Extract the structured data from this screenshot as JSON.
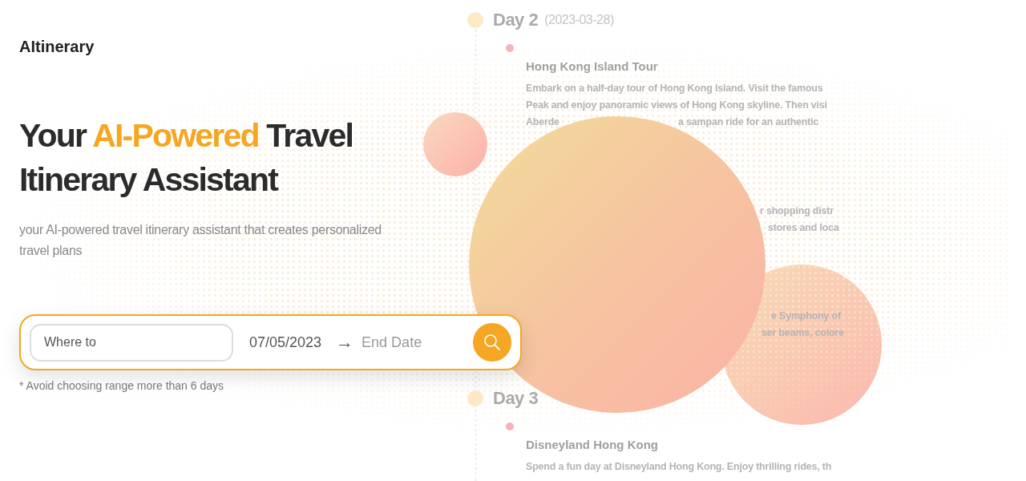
{
  "brand": "AItinerary",
  "hero": {
    "heading_before": "Your ",
    "heading_highlight": "AI-Powered",
    "heading_after": " Travel Itinerary Assistant",
    "subtitle": "your AI-powered travel itinerary assistant that creates personalized travel plans"
  },
  "search": {
    "destination_placeholder": "Where to",
    "start_date": "07/05/2023",
    "arrow": "→",
    "end_date_placeholder": "End Date",
    "note": "* Avoid choosing range more than 6 days"
  },
  "itinerary": {
    "days": [
      {
        "title": "Day 2",
        "date": "(2023-03-28)",
        "activities": [
          {
            "title": "Hong Kong Island Tour",
            "lines": [
              [
                "Embark on a half-day tour of Hong Kong Island. Visit the famous"
              ],
              [
                "Peak and enjoy panoramic views of Hong Kong skyline. Then visi"
              ],
              [
                "Aberde",
                "a sampan ride for an authentic"
              ]
            ]
          },
          {
            "lines": [
              [
                "r shopping distr"
              ],
              [
                "stores and loca"
              ]
            ]
          },
          {
            "lines": [
              [
                "e Symphony of"
              ],
              [
                "ser beams, colore"
              ]
            ]
          }
        ]
      },
      {
        "title": "Day 3",
        "activities": [
          {
            "title": "Disneyland Hong Kong",
            "lines": [
              [
                "Spend a fun day at Disneyland Hong Kong. Enjoy thrilling rides, th"
              ]
            ]
          }
        ]
      }
    ]
  }
}
